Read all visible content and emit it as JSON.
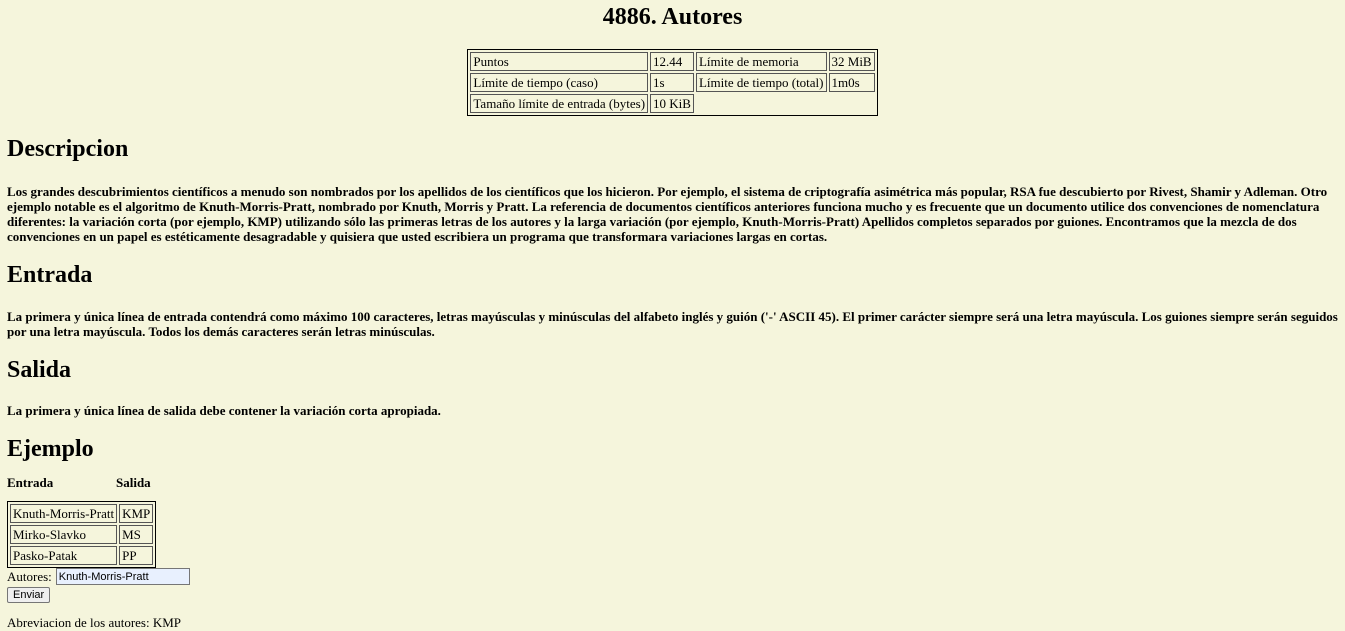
{
  "title": "4886. Autores",
  "limits": {
    "puntos_label": "Puntos",
    "puntos_value": "12.44",
    "memoria_label": "Límite de memoria",
    "memoria_value": "32 MiB",
    "tiempo_caso_label": "Límite de tiempo (caso)",
    "tiempo_caso_value": "1s",
    "tiempo_total_label": "Límite de tiempo (total)",
    "tiempo_total_value": "1m0s",
    "entrada_label": "Tamaño límite de entrada (bytes)",
    "entrada_value": "10 KiB"
  },
  "sections": {
    "descripcion_title": "Descripcion",
    "descripcion_text": "Los grandes descubrimientos científicos a menudo son nombrados por los apellidos de los científicos que los hicieron. Por ejemplo, el sistema de criptografía asimétrica más popular, RSA fue descubierto por Rivest, Shamir y Adleman. Otro ejemplo notable es el algoritmo de Knuth-Morris-Pratt, nombrado por Knuth, Morris y Pratt. La referencia de documentos científicos anteriores funciona mucho y es frecuente que un documento utilice dos convenciones de nomenclatura diferentes: la variación corta (por ejemplo, KMP) utilizando sólo las primeras letras de los autores y la larga variación (por ejemplo, Knuth-Morris-Pratt) Apellidos completos separados por guiones. Encontramos que la mezcla de dos convenciones en un papel es estéticamente desagradable y quisiera que usted escribiera un programa que transformara variaciones largas en cortas.",
    "entrada_title": "Entrada",
    "entrada_text": "La primera y única línea de entrada contendrá como máximo 100 caracteres, letras mayúsculas y minúsculas del alfabeto inglés y guión ('-' ASCII 45). El primer carácter siempre será una letra mayúscula. Los guiones siempre serán seguidos por una letra mayúscula. Todos los demás caracteres serán letras minúsculas.",
    "salida_title": "Salida",
    "salida_text": "La primera y única línea de salida debe contener la variación corta apropiada.",
    "ejemplo_title": "Ejemplo"
  },
  "example": {
    "input_header": "Entrada",
    "output_header": "Salida",
    "rows": [
      {
        "input": "Knuth-Morris-Pratt",
        "output": "KMP"
      },
      {
        "input": "Mirko-Slavko",
        "output": "MS"
      },
      {
        "input": "Pasko-Patak",
        "output": "PP"
      }
    ]
  },
  "form": {
    "label": "Autores:",
    "value": "Knuth-Morris-Pratt",
    "submit_label": "Enviar"
  },
  "result": {
    "text": "Abreviacion de los autores: KMP"
  }
}
